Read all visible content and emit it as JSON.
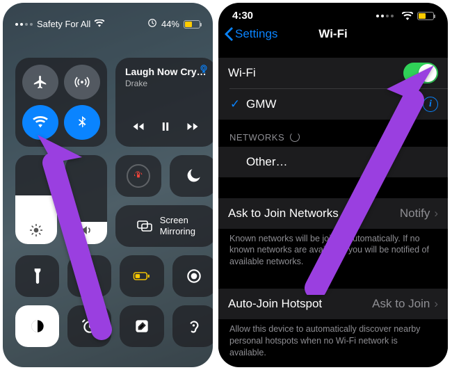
{
  "left": {
    "status": {
      "carrier": "Safety For All",
      "battery_pct": "44%"
    },
    "music": {
      "title": "Laugh Now Cry…",
      "artist": "Drake"
    },
    "mirror": {
      "line1": "Screen",
      "line2": "Mirroring"
    }
  },
  "right": {
    "status": {
      "time": "4:30"
    },
    "nav": {
      "back": "Settings",
      "title": "Wi-Fi"
    },
    "wifi_row": {
      "label": "Wi-Fi"
    },
    "network": {
      "name": "GMW"
    },
    "networks_header": "NETWORKS",
    "other": "Other…",
    "ask": {
      "label": "Ask to Join Networks",
      "value": "Notify"
    },
    "ask_footer": "Known networks will be joined automatically. If no known networks are available, you will be notified of available networks.",
    "hotspot": {
      "label": "Auto-Join Hotspot",
      "value": "Ask to Join"
    },
    "hotspot_footer": "Allow this device to automatically discover nearby personal hotspots when no Wi-Fi network is available."
  }
}
